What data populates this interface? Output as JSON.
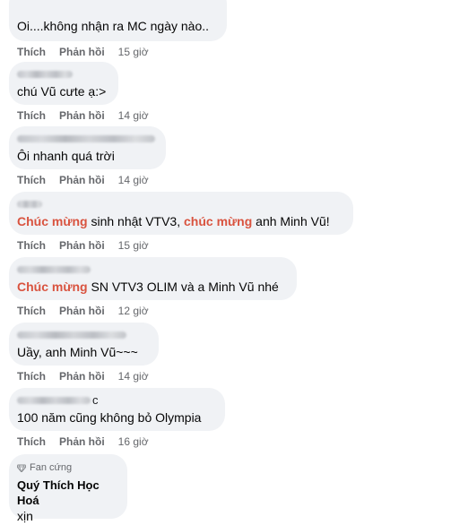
{
  "actions": {
    "like": "Thích",
    "reply": "Phản hồi"
  },
  "comments": [
    {
      "text": "Oi....không nhận ra MC ngày nào..",
      "time": "15 giờ"
    },
    {
      "text": "chú Vũ cưte ạ:>",
      "time": "14 giờ"
    },
    {
      "text": "Ôi nhanh quá trời",
      "time": "14 giờ"
    },
    {
      "hl1": "Chúc mừng",
      "t1": " sinh nhật VTV3, ",
      "hl2": "chúc mừng",
      "t2": " anh Minh Vũ!",
      "time": "15 giờ"
    },
    {
      "hl1": "Chúc mừng",
      "t1": " SN VTV3 OLIM và a Minh Vũ nhé",
      "time": "12 giờ"
    },
    {
      "text": "Uầy, anh Minh Vũ~~~",
      "time": "14 giờ"
    },
    {
      "author_suffix": "c",
      "text": "100 năm cũng không bỏ Olympia",
      "time": "16 giờ"
    },
    {
      "badge": "Fan cứng",
      "author": "Quý Thích Học Hoá",
      "text": "xịn"
    }
  ],
  "colors": {
    "highlight": "#d9533f",
    "bubble": "#f0f2f5",
    "meta": "#65676b"
  },
  "icons": {
    "badge": "diamond-icon"
  }
}
